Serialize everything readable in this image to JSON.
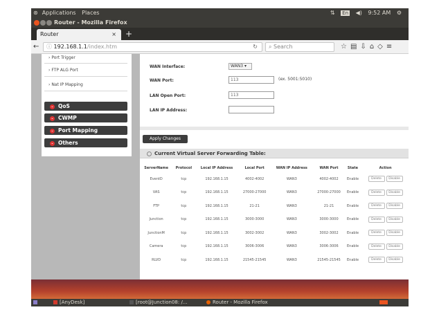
{
  "top_panel": {
    "apps_menu": "Applications",
    "places_menu": "Places",
    "keyboard_layout": "En",
    "clock": "9:52 AM"
  },
  "window": {
    "title": "Router - Mozilla Firefox"
  },
  "tab": {
    "label": "Router",
    "close": "×",
    "new_tab": "+"
  },
  "navbar": {
    "url_host": "192.168.1.1",
    "url_path": "/index.htm",
    "search_placeholder": "Search"
  },
  "sidebar": {
    "links": [
      "Port Trigger",
      "FTP ALG Port",
      "Nat IP Mapping"
    ],
    "menus": [
      "QoS",
      "CWMP",
      "Port Mapping",
      "Others"
    ]
  },
  "form": {
    "wan_interface_label": "WAN Interface:",
    "wan_interface_value": "WAN3",
    "wan_port_label": "WAN Port:",
    "wan_port_value": "113",
    "wan_port_hint": "(ex. 5001:5010)",
    "lan_open_port_label": "LAN Open Port:",
    "lan_open_port_value": "113",
    "lan_ip_label": "LAN IP Address:",
    "lan_ip_value": "",
    "apply_button": "Apply Changes"
  },
  "table": {
    "title": "Current Virtual Server Forwarding Table:",
    "headers": [
      "ServerName",
      "Protocol",
      "Local IP Address",
      "Local Port",
      "WAN IP Address",
      "WAN Port",
      "State",
      "Action"
    ],
    "delete_label": "Delete",
    "disable_label": "Disable",
    "rows": [
      [
        "EventD",
        "tcp",
        "192.168.1.15",
        "4002-4002",
        "WAN3",
        "4002-4002",
        "Enable"
      ],
      [
        "VAS",
        "tcp",
        "192.168.1.15",
        "27000-27000",
        "WAN3",
        "27000-27000",
        "Enable"
      ],
      [
        "FTP",
        "tcp",
        "192.168.1.15",
        "21-21",
        "WAN3",
        "21-21",
        "Enable"
      ],
      [
        "Junction",
        "tcp",
        "192.168.1.15",
        "3000-3000",
        "WAN3",
        "3000-3000",
        "Enable"
      ],
      [
        "JunctionM",
        "tcp",
        "192.168.1.15",
        "3002-3002",
        "WAN3",
        "3002-3002",
        "Enable"
      ],
      [
        "Camera",
        "tcp",
        "192.168.1.15",
        "3006-3006",
        "WAN3",
        "3006-3006",
        "Enable"
      ],
      [
        "RLVD",
        "tcp",
        "192.168.1.15",
        "21545-21545",
        "WAN3",
        "21545-21545",
        "Enable"
      ]
    ]
  },
  "taskbar": {
    "items": [
      "[AnyDesk]",
      "[root@Junction08: /...",
      "Router - Mozilla Firefox"
    ]
  }
}
